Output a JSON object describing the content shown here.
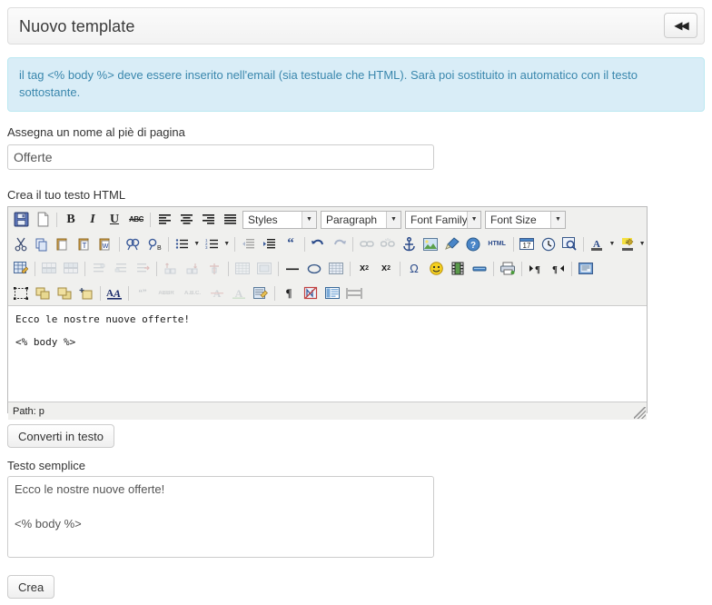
{
  "header": {
    "title": "Nuovo template",
    "back_button_icon": "rewind-double-left-icon",
    "back_button_glyph": "◀◀"
  },
  "alert": {
    "type": "info",
    "text": "il tag <% body %> deve essere inserito nell'email (sia testuale che HTML). Sarà poi sostituito in automatico con il testo sottostante.",
    "bg_color": "#d9edf7",
    "border_color": "#bce8f1",
    "text_color": "#3a87ad"
  },
  "form": {
    "name_label": "Assegna un nome al piè di pagina",
    "name_value": "Offerte",
    "name_placeholder": "",
    "html_label": "Crea il tuo testo HTML",
    "plain_label": "Testo semplice",
    "plain_value": "Ecco le nostre nuove offerte!\n\n<% body %>",
    "plain_placeholder": "",
    "convert_button": "Converti in testo",
    "submit_button": "Crea"
  },
  "editor": {
    "status_path": "Path: p",
    "content_lines": [
      "Ecco le nostre nuove offerte!",
      "<% body %>"
    ],
    "selects": [
      {
        "name": "styles",
        "value": "Styles"
      },
      {
        "name": "paragraph",
        "value": "Paragraph"
      },
      {
        "name": "fontfamily",
        "value": "Font Family"
      },
      {
        "name": "fontsize",
        "value": "Font Size"
      }
    ],
    "toolbar_rows": [
      {
        "row": 1,
        "items": [
          {
            "icon": "save-icon",
            "glyph": "💾",
            "disabled": false
          },
          {
            "icon": "new-document-icon",
            "glyph": "📄",
            "disabled": false
          },
          {
            "icon": "separator",
            "glyph": "",
            "disabled": false
          },
          {
            "icon": "bold-icon",
            "glyph": "B",
            "disabled": false
          },
          {
            "icon": "italic-icon",
            "glyph": "I",
            "disabled": false
          },
          {
            "icon": "underline-icon",
            "glyph": "U",
            "disabled": false
          },
          {
            "icon": "strikethrough-icon",
            "glyph": "ABC",
            "disabled": false
          },
          {
            "icon": "separator",
            "glyph": "",
            "disabled": false
          },
          {
            "icon": "align-left-icon",
            "glyph": "☰",
            "disabled": false
          },
          {
            "icon": "align-center-icon",
            "glyph": "☰",
            "disabled": false
          },
          {
            "icon": "align-right-icon",
            "glyph": "☰",
            "disabled": false
          },
          {
            "icon": "align-justify-icon",
            "glyph": "☰",
            "disabled": false
          }
        ]
      },
      {
        "row": 2,
        "items": [
          {
            "icon": "cut-icon",
            "glyph": "✂",
            "disabled": false
          },
          {
            "icon": "copy-icon",
            "glyph": "⧉",
            "disabled": false
          },
          {
            "icon": "paste-icon",
            "glyph": "📋",
            "disabled": false
          },
          {
            "icon": "paste-as-text-icon",
            "glyph": "T",
            "disabled": false
          },
          {
            "icon": "paste-from-word-icon",
            "glyph": "W",
            "disabled": false
          },
          {
            "icon": "separator",
            "glyph": "",
            "disabled": false
          },
          {
            "icon": "search-icon",
            "glyph": "🔍",
            "disabled": false
          },
          {
            "icon": "search-replace-icon",
            "glyph": "↻",
            "disabled": false
          },
          {
            "icon": "separator",
            "glyph": "",
            "disabled": false
          },
          {
            "icon": "bullet-list-icon",
            "glyph": "☰",
            "disabled": false
          },
          {
            "icon": "bullet-list-dropdown-arrow-icon",
            "glyph": "▼",
            "disabled": false
          },
          {
            "icon": "numbered-list-icon",
            "glyph": "☰",
            "disabled": false
          },
          {
            "icon": "numbered-list-dropdown-arrow-icon",
            "glyph": "▼",
            "disabled": false
          },
          {
            "icon": "separator",
            "glyph": "",
            "disabled": false
          },
          {
            "icon": "outdent-icon",
            "glyph": "⇤",
            "disabled": true
          },
          {
            "icon": "indent-icon",
            "glyph": "⇥",
            "disabled": false
          },
          {
            "icon": "blockquote-icon",
            "glyph": "“",
            "disabled": false
          },
          {
            "icon": "separator",
            "glyph": "",
            "disabled": false
          },
          {
            "icon": "undo-icon",
            "glyph": "↶",
            "disabled": false
          },
          {
            "icon": "redo-icon",
            "glyph": "↷",
            "disabled": true
          },
          {
            "icon": "separator",
            "glyph": "",
            "disabled": false
          },
          {
            "icon": "insert-link-icon",
            "glyph": "🔗",
            "disabled": true
          },
          {
            "icon": "unlink-icon",
            "glyph": "🔗",
            "disabled": true
          },
          {
            "icon": "anchor-icon",
            "glyph": "⚓",
            "disabled": false
          },
          {
            "icon": "insert-image-icon",
            "glyph": "🖼",
            "disabled": false
          },
          {
            "icon": "cleanup-code-icon",
            "glyph": "🧹",
            "disabled": false
          },
          {
            "icon": "help-icon",
            "glyph": "?",
            "disabled": false
          },
          {
            "icon": "edit-html-source-icon",
            "glyph": "HTML",
            "disabled": false
          },
          {
            "icon": "separator",
            "glyph": "",
            "disabled": false
          },
          {
            "icon": "insert-date-icon",
            "glyph": "📅",
            "disabled": false
          },
          {
            "icon": "insert-time-icon",
            "glyph": "🕓",
            "disabled": false
          },
          {
            "icon": "preview-icon",
            "glyph": "🔎",
            "disabled": false
          },
          {
            "icon": "separator",
            "glyph": "",
            "disabled": false
          },
          {
            "icon": "text-color-icon",
            "glyph": "A",
            "disabled": false
          },
          {
            "icon": "text-color-dropdown-arrow-icon",
            "glyph": "▼",
            "disabled": false
          },
          {
            "icon": "background-color-icon",
            "glyph": "ab",
            "disabled": false
          },
          {
            "icon": "background-color-dropdown-arrow-icon",
            "glyph": "▼",
            "disabled": false
          }
        ]
      },
      {
        "row": 3,
        "items": [
          {
            "icon": "table-properties-icon",
            "glyph": "▦",
            "disabled": false
          },
          {
            "icon": "separator",
            "glyph": "",
            "disabled": false
          },
          {
            "icon": "insert-row-before-icon",
            "glyph": "▤",
            "disabled": true
          },
          {
            "icon": "insert-row-after-icon",
            "glyph": "▤",
            "disabled": true
          },
          {
            "icon": "separator",
            "glyph": "",
            "disabled": false
          },
          {
            "icon": "delete-row-icon",
            "glyph": "≡",
            "disabled": true
          },
          {
            "icon": "insert-column-before-icon",
            "glyph": "≡",
            "disabled": true
          },
          {
            "icon": "insert-column-after-icon",
            "glyph": "≡",
            "disabled": true
          },
          {
            "icon": "separator",
            "glyph": "",
            "disabled": false
          },
          {
            "icon": "split-cell-icon",
            "glyph": "⊓",
            "disabled": true
          },
          {
            "icon": "merge-cells-icon",
            "glyph": "⊔",
            "disabled": true
          },
          {
            "icon": "delete-column-icon",
            "glyph": "⊥",
            "disabled": true
          },
          {
            "icon": "separator",
            "glyph": "",
            "disabled": false
          },
          {
            "icon": "table-grid-icon",
            "glyph": "▦",
            "disabled": true
          },
          {
            "icon": "cell-properties-icon",
            "glyph": "▣",
            "disabled": true
          },
          {
            "icon": "separator",
            "glyph": "",
            "disabled": false
          },
          {
            "icon": "horizontal-rule-icon",
            "glyph": "—",
            "disabled": false
          },
          {
            "icon": "remove-format-icon",
            "glyph": "⬭",
            "disabled": false
          },
          {
            "icon": "visual-aid-icon",
            "glyph": "░",
            "disabled": false
          },
          {
            "icon": "insert-layer-icon",
            "glyph": "▦",
            "disabled": false
          },
          {
            "icon": "separator",
            "glyph": "",
            "disabled": false
          },
          {
            "icon": "subscript-icon",
            "glyph": "x₂",
            "disabled": false
          },
          {
            "icon": "superscript-icon",
            "glyph": "x²",
            "disabled": false
          },
          {
            "icon": "separator",
            "glyph": "",
            "disabled": false
          },
          {
            "icon": "special-character-icon",
            "glyph": "Ω",
            "disabled": false
          },
          {
            "icon": "emoticon-icon",
            "glyph": "🙂",
            "disabled": false
          },
          {
            "icon": "insert-media-icon",
            "glyph": "🎞",
            "disabled": false
          },
          {
            "icon": "page-break-icon",
            "glyph": "▬",
            "disabled": false
          },
          {
            "icon": "separator",
            "glyph": "",
            "disabled": false
          },
          {
            "icon": "print-icon",
            "glyph": "🖨",
            "disabled": false
          },
          {
            "icon": "separator",
            "glyph": "",
            "disabled": false
          },
          {
            "icon": "ltr-direction-icon",
            "glyph": "¶",
            "disabled": false
          },
          {
            "icon": "rtl-direction-icon",
            "glyph": "¶",
            "disabled": false
          },
          {
            "icon": "separator",
            "glyph": "",
            "disabled": false
          },
          {
            "icon": "fullscreen-icon",
            "glyph": "▣",
            "disabled": false
          }
        ]
      },
      {
        "row": 4,
        "items": [
          {
            "icon": "select-all-icon",
            "glyph": "⬚",
            "disabled": false
          },
          {
            "icon": "move-forward-icon",
            "glyph": "⧉",
            "disabled": false
          },
          {
            "icon": "move-backward-icon",
            "glyph": "⧉",
            "disabled": false
          },
          {
            "icon": "insert-layer-new-icon",
            "glyph": "⊞",
            "disabled": false
          },
          {
            "icon": "separator",
            "glyph": "",
            "disabled": false
          },
          {
            "icon": "style-props-icon",
            "glyph": "A",
            "disabled": false
          },
          {
            "icon": "separator",
            "glyph": "",
            "disabled": false
          },
          {
            "icon": "citation-icon",
            "glyph": "“”",
            "disabled": true
          },
          {
            "icon": "abbreviation-icon",
            "glyph": "ABBR",
            "disabled": true
          },
          {
            "icon": "acronym-icon",
            "glyph": "A.B.C.",
            "disabled": true
          },
          {
            "icon": "deletion-icon",
            "glyph": "A",
            "disabled": true
          },
          {
            "icon": "insertion-icon",
            "glyph": "A",
            "disabled": true
          },
          {
            "icon": "attributes-icon",
            "glyph": "📝",
            "disabled": false
          },
          {
            "icon": "separator",
            "glyph": "",
            "disabled": false
          },
          {
            "icon": "show-invisible-chars-icon",
            "glyph": "¶",
            "disabled": false
          },
          {
            "icon": "toggle-nonbreaking-icon",
            "glyph": "⌦",
            "disabled": false
          },
          {
            "icon": "template-icon",
            "glyph": "▥",
            "disabled": false
          },
          {
            "icon": "page-break-alt-icon",
            "glyph": "═",
            "disabled": false
          }
        ]
      }
    ]
  }
}
